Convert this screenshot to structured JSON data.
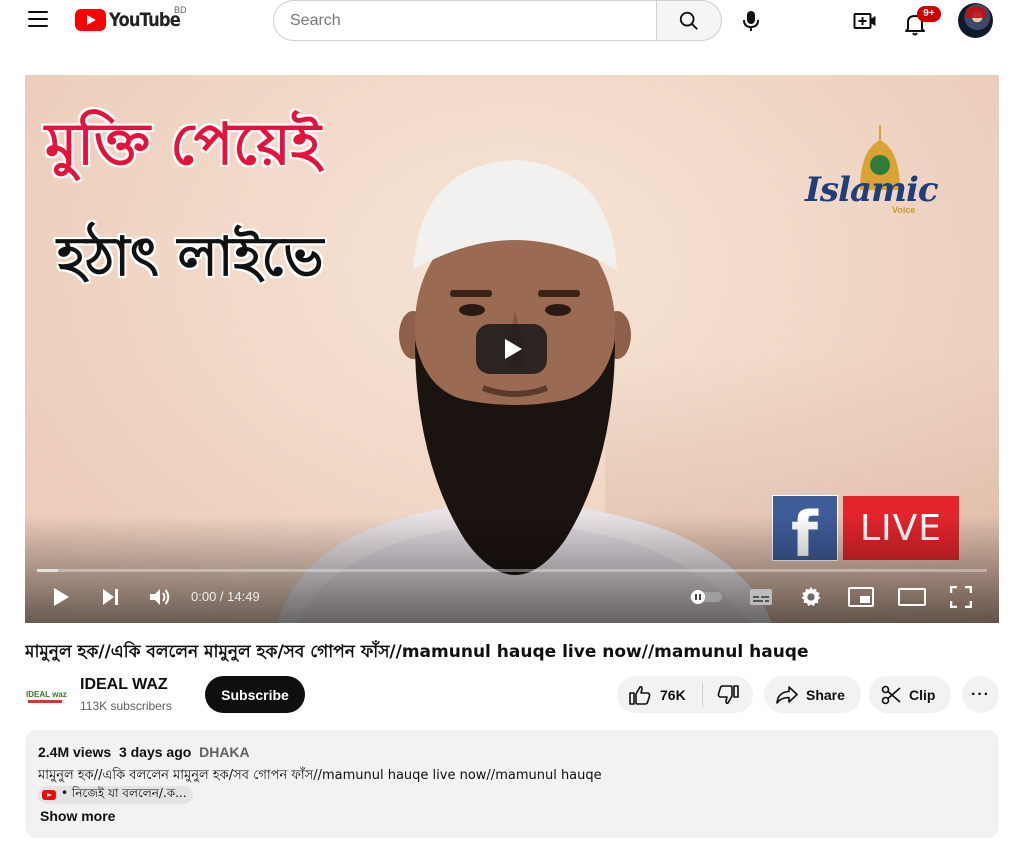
{
  "header": {
    "logo_text": "YouTube",
    "country_code": "BD",
    "search_placeholder": "Search",
    "notification_count": "9+"
  },
  "player": {
    "overlay_line1": "মুক্তি পেয়েই",
    "overlay_line2": "হঠাৎ লাইভে",
    "watermark_brand": "Islamic",
    "watermark_sub": "Voice",
    "fb_letter": "f",
    "live_label": "LIVE",
    "time_display": "0:00 / 14:49",
    "progress_loaded_fraction": 0.022
  },
  "video": {
    "title": "মামুনুল হক//একি বললেন মামুনুল হক/সব গোপন ফাঁস//mamunul hauqe live now//mamunul hauqe",
    "channel_logo_text": "IDEAL waz",
    "channel_name": "IDEAL WAZ",
    "subscribers": "113K subscribers",
    "subscribe_label": "Subscribe",
    "likes": "76K",
    "share_label": "Share",
    "clip_label": "Clip",
    "more_label": "···"
  },
  "description": {
    "views": "2.4M views",
    "date": "3 days ago",
    "location": "DHAKA",
    "text": "মামুনুল হক//একি বললেন মামুনুল হক/সব গোপন ফাঁস//mamunul hauqe live now//mamunul hauqe",
    "tag_text": "• নিজেই যা বললেন/.ক...",
    "show_more": "Show more"
  },
  "icons": {
    "menu": "hamburger-icon",
    "search": "search-icon",
    "mic": "mic-icon",
    "create": "create-video-icon",
    "bell": "bell-icon",
    "play": "play-icon",
    "next": "next-icon",
    "volume": "volume-icon",
    "autoplay": "autoplay-toggle-icon",
    "subtitles": "subtitles-icon",
    "settings": "gear-icon",
    "miniplayer": "miniplayer-icon",
    "theater": "theater-icon",
    "fullscreen": "fullscreen-icon",
    "like": "thumbs-up-icon",
    "dislike": "thumbs-down-icon",
    "share": "share-icon",
    "clip": "scissors-icon"
  },
  "colors": {
    "brand_red": "#ff0000",
    "overlay_red": "#e5123b",
    "facebook_blue": "#3e5c9a",
    "live_red": "#e3242b"
  }
}
